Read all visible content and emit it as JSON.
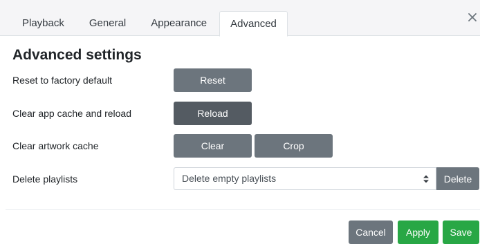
{
  "tabs": [
    {
      "label": "Playback"
    },
    {
      "label": "General"
    },
    {
      "label": "Appearance"
    },
    {
      "label": "Advanced"
    }
  ],
  "active_tab": "Advanced",
  "close_icon": "close-icon",
  "heading": "Advanced settings",
  "rows": {
    "reset": {
      "label": "Reset to factory default",
      "button": "Reset"
    },
    "cache": {
      "label": "Clear app cache and reload",
      "button": "Reload"
    },
    "artwork": {
      "label": "Clear artwork cache",
      "clear_button": "Clear",
      "crop_button": "Crop"
    },
    "playlists": {
      "label": "Delete playlists",
      "selected_option": "Delete empty playlists",
      "button": "Delete"
    }
  },
  "footer": {
    "cancel": "Cancel",
    "apply": "Apply",
    "save": "Save"
  },
  "colors": {
    "secondary": "#6c757d",
    "secondary_active": "#545b62",
    "success": "#28a745"
  }
}
